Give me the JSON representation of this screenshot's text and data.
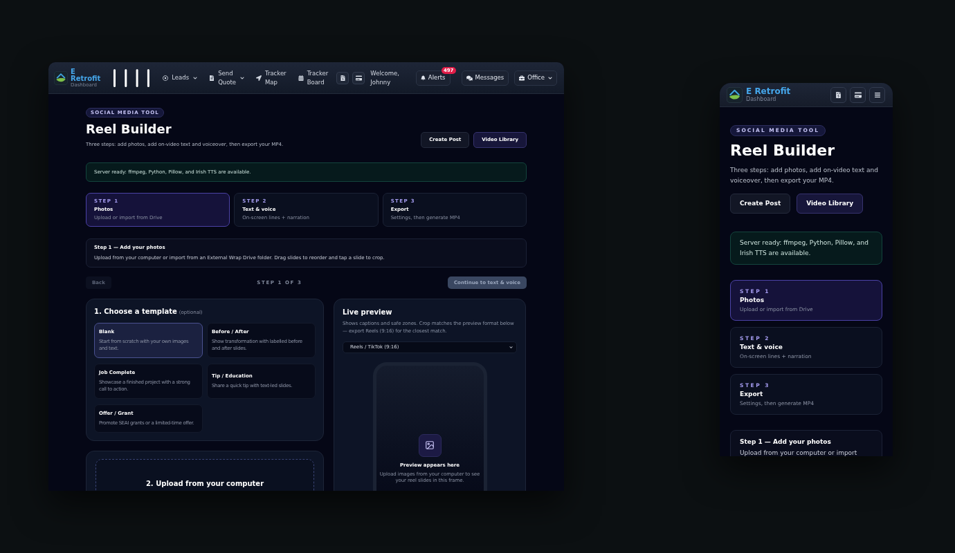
{
  "desktop": {
    "header": {
      "brand": {
        "name": "E Retrofit",
        "subtitle": "Dashboard"
      },
      "nav": [
        {
          "label": "Leads",
          "dropdown": true
        },
        {
          "label": "Send Quote",
          "dropdown": true
        },
        {
          "label": "Tracker Map",
          "dropdown": false
        },
        {
          "label": "Tracker Board",
          "dropdown": false
        }
      ],
      "welcome": "Welcome, Johnny",
      "alerts": {
        "label": "Alerts",
        "badge": "497"
      },
      "messages": {
        "label": "Messages"
      },
      "office": {
        "label": "Office",
        "dropdown": true
      }
    },
    "page": {
      "badge": "SOCIAL MEDIA TOOL",
      "title": "Reel Builder",
      "subtitle": "Three steps: add photos, add on-video text and voiceover, then export your MP4.",
      "actions": [
        {
          "label": "Create Post",
          "kind": "secondary"
        },
        {
          "label": "Video Library",
          "kind": "primary"
        }
      ],
      "status": "Server ready: ffmpeg, Python, Pillow, and Irish TTS are available.",
      "steps": [
        {
          "label": "STEP 1",
          "title": "Photos",
          "description": "Upload or import from Drive",
          "selected": true
        },
        {
          "label": "STEP 2",
          "title": "Text & voice",
          "description": "On-screen lines + narration",
          "selected": false
        },
        {
          "label": "STEP 3",
          "title": "Export",
          "description": "Settings, then generate MP4",
          "selected": false
        }
      ],
      "step_info": {
        "title": "Step 1 — Add your photos",
        "description": "Upload from your computer or import from an External Wrap Drive folder. Drag slides to reorder and tap a slide to crop."
      },
      "step_nav": {
        "back": {
          "label": "Back",
          "disabled": true
        },
        "progress": "STEP 1 OF 3",
        "next": {
          "label": "Continue to text & voice",
          "disabled": true
        }
      },
      "templates": {
        "title": "1. Choose a template",
        "note": "(optional)",
        "items": [
          {
            "title": "Blank",
            "description": "Start from scratch with your own images and text.",
            "selected": true
          },
          {
            "title": "Before / After",
            "description": "Show transformation with labelled before and after slides.",
            "selected": false
          },
          {
            "title": "Job Complete",
            "description": "Showcase a finished project with a strong call to action.",
            "selected": false
          },
          {
            "title": "Tip / Education",
            "description": "Share a quick tip with text-led slides.",
            "selected": false
          },
          {
            "title": "Offer / Grant",
            "description": "Promote SEAI grants or a limited-time offer.",
            "selected": false
          }
        ]
      },
      "upload": {
        "title": "2. Upload from your computer"
      },
      "preview": {
        "title": "Live preview",
        "description": "Shows captions and safe zones. Crop matches the preview format below — export Reels (9:16) for the closest match.",
        "format": {
          "value": "Reels / TikTok (9:16)"
        },
        "empty_title": "Preview appears here",
        "empty_text": "Upload images from your computer to see your reel slides in this frame."
      }
    }
  },
  "mobile": {
    "header": {
      "brand": {
        "name": "E Retrofit",
        "subtitle": "Dashboard"
      }
    },
    "page": {
      "badge": "SOCIAL MEDIA TOOL",
      "title": "Reel Builder",
      "subtitle": "Three steps: add photos, add on-video text and voiceover, then export your MP4.",
      "actions": [
        {
          "label": "Create Post",
          "kind": "secondary"
        },
        {
          "label": "Video Library",
          "kind": "primary"
        }
      ],
      "status": "Server ready: ffmpeg, Python, Pillow, and Irish TTS are available.",
      "steps": [
        {
          "label": "STEP 1",
          "title": "Photos",
          "description": "Upload or import from Drive",
          "selected": true
        },
        {
          "label": "STEP 2",
          "title": "Text & voice",
          "description": "On-screen lines + narration",
          "selected": false
        },
        {
          "label": "STEP 3",
          "title": "Export",
          "description": "Settings, then generate MP4",
          "selected": false
        }
      ],
      "step_info": {
        "title": "Step 1 — Add your photos",
        "description": "Upload from your computer or import"
      }
    }
  }
}
